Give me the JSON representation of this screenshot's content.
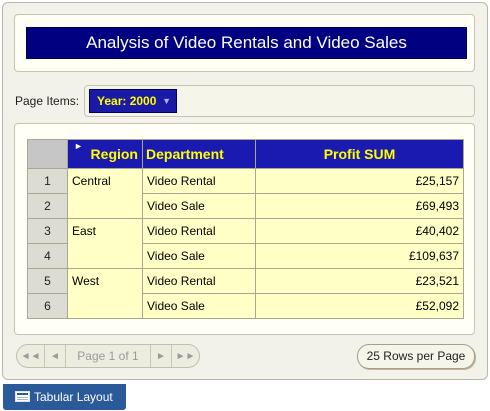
{
  "report": {
    "title": "Analysis of Video Rentals and Video Sales"
  },
  "page_items": {
    "label": "Page Items:",
    "year_select": "Year: 2000"
  },
  "table": {
    "headers": {
      "region": "Region",
      "department": "Department",
      "profit": "Profit SUM"
    },
    "rows": [
      {
        "num": "1",
        "region": "Central",
        "department": "Video Rental",
        "profit": "£25,157"
      },
      {
        "num": "2",
        "region": "",
        "department": "Video Sale",
        "profit": "£69,493"
      },
      {
        "num": "3",
        "region": "East",
        "department": "Video Rental",
        "profit": "£40,402"
      },
      {
        "num": "4",
        "region": "",
        "department": "Video Sale",
        "profit": "£109,637"
      },
      {
        "num": "5",
        "region": "West",
        "department": "Video Rental",
        "profit": "£23,521"
      },
      {
        "num": "6",
        "region": "",
        "department": "Video Sale",
        "profit": "£52,092"
      }
    ]
  },
  "pager": {
    "label": "Page 1 of 1",
    "rows_per_page": "25 Rows per Page"
  },
  "layout_tab": {
    "label": "Tabular Layout"
  },
  "icons": {
    "first": "first-page-icon",
    "prev": "prev-page-icon",
    "next": "next-page-icon",
    "last": "last-page-icon",
    "sort": "sort-indicator-icon",
    "dropdown": "chevron-down-icon",
    "layout": "table-icon"
  },
  "colors": {
    "title_bg": "#000080",
    "header_bg": "#1a1ab0",
    "header_text": "#ffff00",
    "cell_bg": "#ffffc6",
    "tab_bg": "#2a5a9a"
  }
}
